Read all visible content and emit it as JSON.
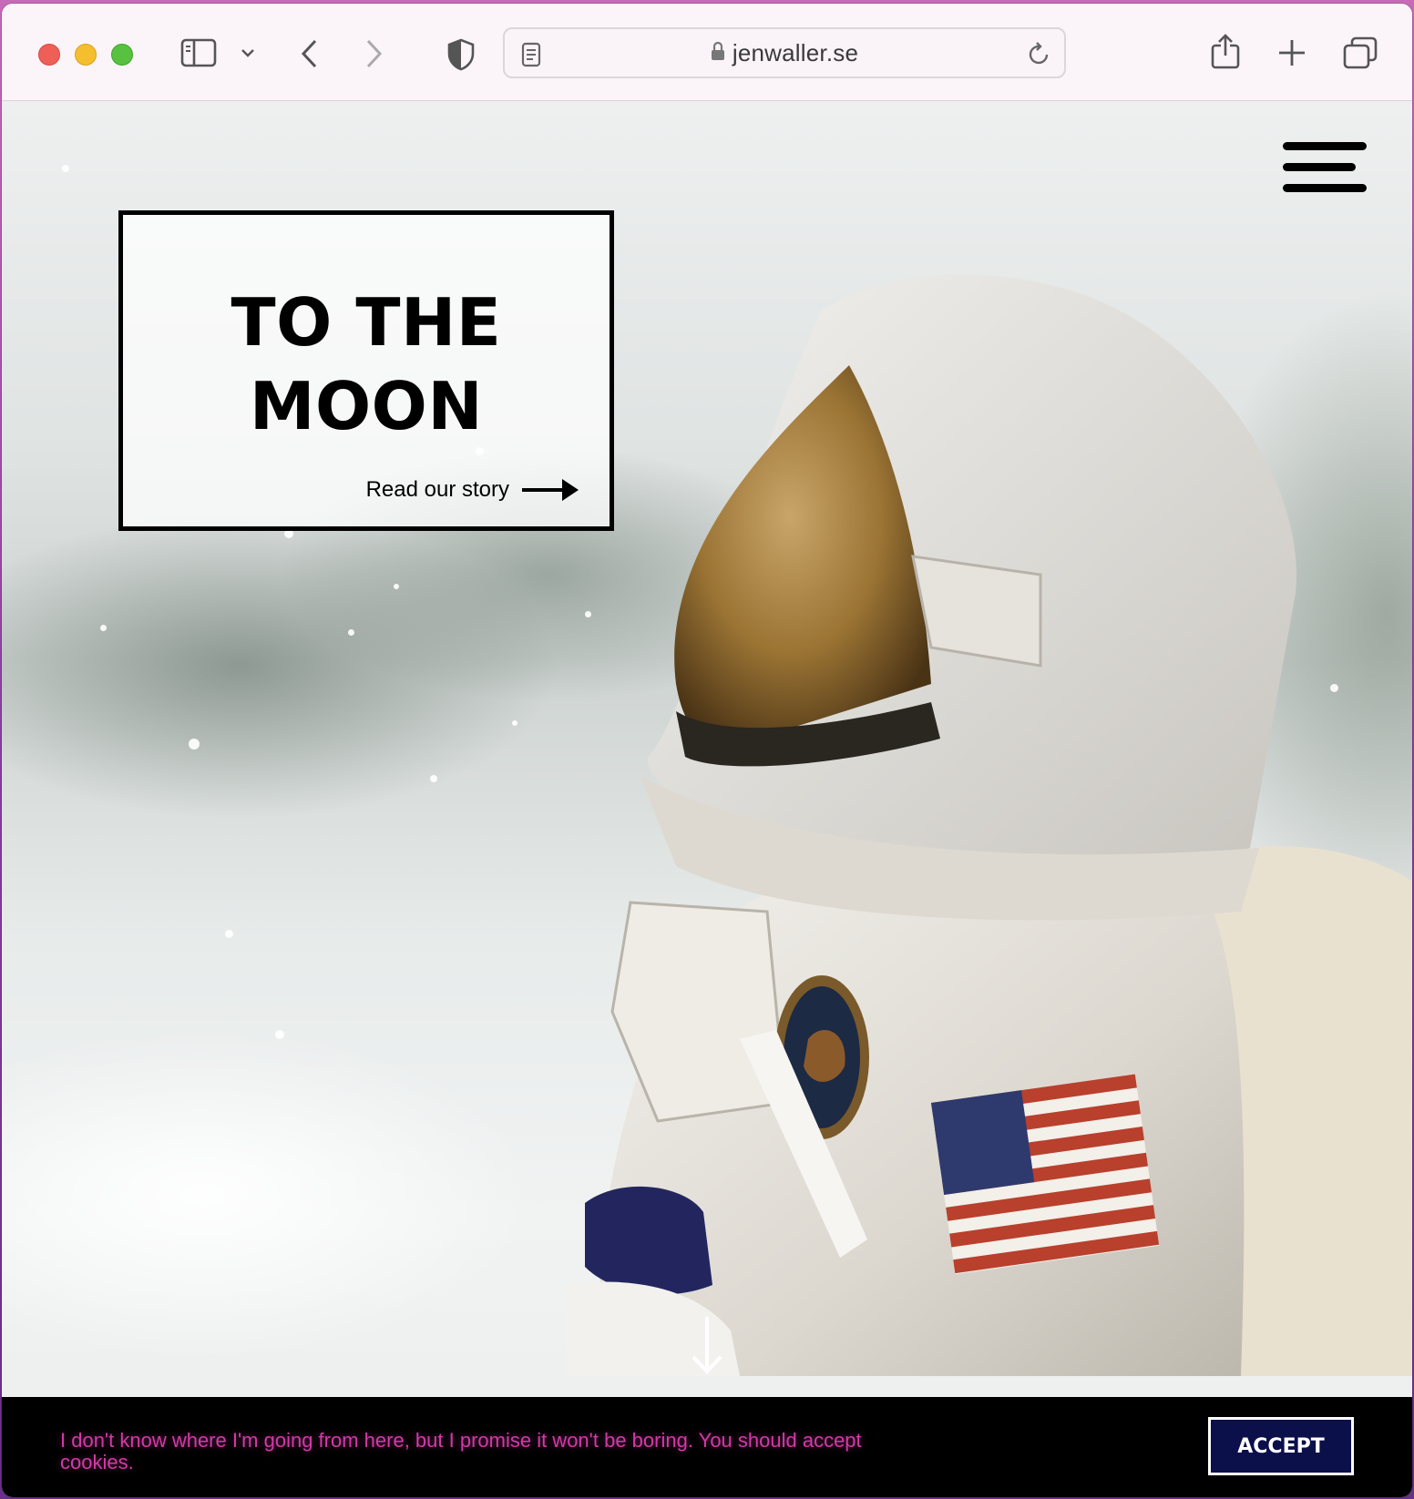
{
  "browser": {
    "url": "jenwaller.se",
    "icons": {
      "sidebar": "sidebar-icon",
      "back": "chevron-left-icon",
      "forward": "chevron-right-icon",
      "privacy": "shield-icon",
      "share": "share-icon",
      "new_tab": "plus-icon",
      "tabs": "tab-overview-icon"
    }
  },
  "hero": {
    "title_line1": "TO THE",
    "title_line2": "MOON",
    "link_label": "Read our story"
  },
  "cookie_banner": {
    "text": "I don't know where I'm going from here, but I promise it won't be boring. You should accept cookies.",
    "accept_label": "ACCEPT"
  },
  "colors": {
    "cookie_text": "#d23aa6",
    "accept_bg": "#0b0f4a",
    "toolbar_bg": "#fbf4f9"
  }
}
